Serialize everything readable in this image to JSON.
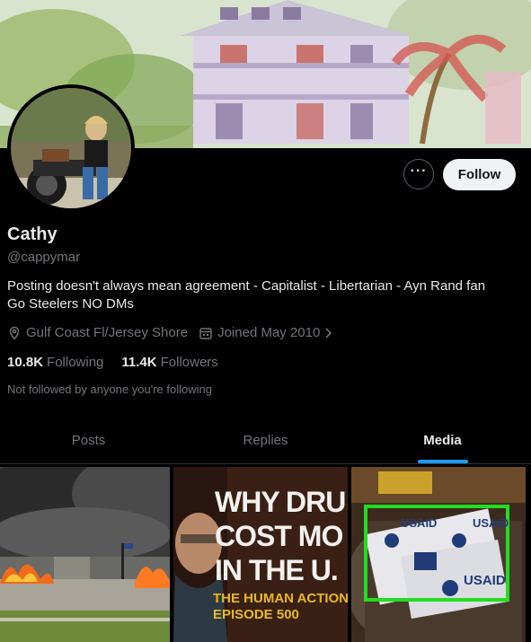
{
  "profile": {
    "name": "Cathy",
    "handle": "@cappymar",
    "bio_line1": "Posting doesn't always mean agreement - Capitalist - Libertarian - Ayn Rand fan",
    "bio_line2": "Go Steelers  NO DMs",
    "location": "Gulf Coast Fl/Jersey Shore",
    "joined": "Joined May 2010",
    "following_count": "10.8K",
    "following_label": "Following",
    "followers_count": "11.4K",
    "followers_label": "Followers",
    "not_followed_note": "Not followed by anyone you're following"
  },
  "actions": {
    "more_label": "···",
    "follow_label": "Follow"
  },
  "tabs": [
    {
      "label": "Posts",
      "active": false
    },
    {
      "label": "Replies",
      "active": false
    },
    {
      "label": "Media",
      "active": true
    }
  ],
  "media": [
    {
      "kind": "photo",
      "subject": "burning building"
    },
    {
      "kind": "thumbnail",
      "title": "WHY DRU\nCOST MO\nIN THE U.",
      "subtitle": "THE HUMAN ACTION\nEPISODE 500"
    },
    {
      "kind": "photo",
      "sign_text": "USAID"
    }
  ],
  "colors": {
    "background": "#000000",
    "accent": "#1d9bf0",
    "text_primary": "#e7e9ea",
    "text_secondary": "#71767b",
    "follow_bg": "#eff3f4",
    "highlight_box": "#22dd22"
  },
  "icons": {
    "location": "location-pin-icon",
    "calendar": "calendar-icon",
    "chevron": "chevron-right-icon"
  }
}
